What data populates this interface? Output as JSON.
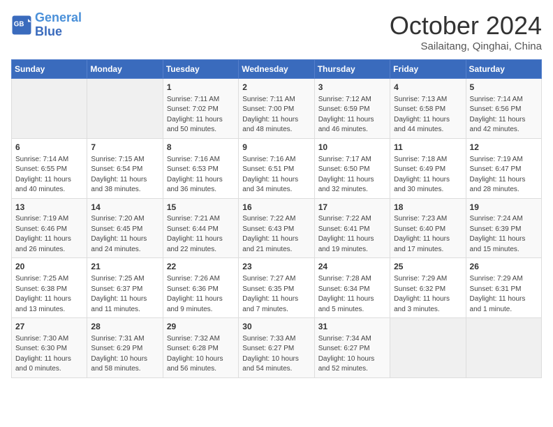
{
  "header": {
    "logo_line1": "General",
    "logo_line2": "Blue",
    "month_title": "October 2024",
    "subtitle": "Sailaitang, Qinghai, China"
  },
  "weekdays": [
    "Sunday",
    "Monday",
    "Tuesday",
    "Wednesday",
    "Thursday",
    "Friday",
    "Saturday"
  ],
  "weeks": [
    [
      {
        "day": "",
        "info": ""
      },
      {
        "day": "",
        "info": ""
      },
      {
        "day": "1",
        "info": "Sunrise: 7:11 AM\nSunset: 7:02 PM\nDaylight: 11 hours\nand 50 minutes."
      },
      {
        "day": "2",
        "info": "Sunrise: 7:11 AM\nSunset: 7:00 PM\nDaylight: 11 hours\nand 48 minutes."
      },
      {
        "day": "3",
        "info": "Sunrise: 7:12 AM\nSunset: 6:59 PM\nDaylight: 11 hours\nand 46 minutes."
      },
      {
        "day": "4",
        "info": "Sunrise: 7:13 AM\nSunset: 6:58 PM\nDaylight: 11 hours\nand 44 minutes."
      },
      {
        "day": "5",
        "info": "Sunrise: 7:14 AM\nSunset: 6:56 PM\nDaylight: 11 hours\nand 42 minutes."
      }
    ],
    [
      {
        "day": "6",
        "info": "Sunrise: 7:14 AM\nSunset: 6:55 PM\nDaylight: 11 hours\nand 40 minutes."
      },
      {
        "day": "7",
        "info": "Sunrise: 7:15 AM\nSunset: 6:54 PM\nDaylight: 11 hours\nand 38 minutes."
      },
      {
        "day": "8",
        "info": "Sunrise: 7:16 AM\nSunset: 6:53 PM\nDaylight: 11 hours\nand 36 minutes."
      },
      {
        "day": "9",
        "info": "Sunrise: 7:16 AM\nSunset: 6:51 PM\nDaylight: 11 hours\nand 34 minutes."
      },
      {
        "day": "10",
        "info": "Sunrise: 7:17 AM\nSunset: 6:50 PM\nDaylight: 11 hours\nand 32 minutes."
      },
      {
        "day": "11",
        "info": "Sunrise: 7:18 AM\nSunset: 6:49 PM\nDaylight: 11 hours\nand 30 minutes."
      },
      {
        "day": "12",
        "info": "Sunrise: 7:19 AM\nSunset: 6:47 PM\nDaylight: 11 hours\nand 28 minutes."
      }
    ],
    [
      {
        "day": "13",
        "info": "Sunrise: 7:19 AM\nSunset: 6:46 PM\nDaylight: 11 hours\nand 26 minutes."
      },
      {
        "day": "14",
        "info": "Sunrise: 7:20 AM\nSunset: 6:45 PM\nDaylight: 11 hours\nand 24 minutes."
      },
      {
        "day": "15",
        "info": "Sunrise: 7:21 AM\nSunset: 6:44 PM\nDaylight: 11 hours\nand 22 minutes."
      },
      {
        "day": "16",
        "info": "Sunrise: 7:22 AM\nSunset: 6:43 PM\nDaylight: 11 hours\nand 21 minutes."
      },
      {
        "day": "17",
        "info": "Sunrise: 7:22 AM\nSunset: 6:41 PM\nDaylight: 11 hours\nand 19 minutes."
      },
      {
        "day": "18",
        "info": "Sunrise: 7:23 AM\nSunset: 6:40 PM\nDaylight: 11 hours\nand 17 minutes."
      },
      {
        "day": "19",
        "info": "Sunrise: 7:24 AM\nSunset: 6:39 PM\nDaylight: 11 hours\nand 15 minutes."
      }
    ],
    [
      {
        "day": "20",
        "info": "Sunrise: 7:25 AM\nSunset: 6:38 PM\nDaylight: 11 hours\nand 13 minutes."
      },
      {
        "day": "21",
        "info": "Sunrise: 7:25 AM\nSunset: 6:37 PM\nDaylight: 11 hours\nand 11 minutes."
      },
      {
        "day": "22",
        "info": "Sunrise: 7:26 AM\nSunset: 6:36 PM\nDaylight: 11 hours\nand 9 minutes."
      },
      {
        "day": "23",
        "info": "Sunrise: 7:27 AM\nSunset: 6:35 PM\nDaylight: 11 hours\nand 7 minutes."
      },
      {
        "day": "24",
        "info": "Sunrise: 7:28 AM\nSunset: 6:34 PM\nDaylight: 11 hours\nand 5 minutes."
      },
      {
        "day": "25",
        "info": "Sunrise: 7:29 AM\nSunset: 6:32 PM\nDaylight: 11 hours\nand 3 minutes."
      },
      {
        "day": "26",
        "info": "Sunrise: 7:29 AM\nSunset: 6:31 PM\nDaylight: 11 hours\nand 1 minute."
      }
    ],
    [
      {
        "day": "27",
        "info": "Sunrise: 7:30 AM\nSunset: 6:30 PM\nDaylight: 11 hours\nand 0 minutes."
      },
      {
        "day": "28",
        "info": "Sunrise: 7:31 AM\nSunset: 6:29 PM\nDaylight: 10 hours\nand 58 minutes."
      },
      {
        "day": "29",
        "info": "Sunrise: 7:32 AM\nSunset: 6:28 PM\nDaylight: 10 hours\nand 56 minutes."
      },
      {
        "day": "30",
        "info": "Sunrise: 7:33 AM\nSunset: 6:27 PM\nDaylight: 10 hours\nand 54 minutes."
      },
      {
        "day": "31",
        "info": "Sunrise: 7:34 AM\nSunset: 6:27 PM\nDaylight: 10 hours\nand 52 minutes."
      },
      {
        "day": "",
        "info": ""
      },
      {
        "day": "",
        "info": ""
      }
    ]
  ]
}
